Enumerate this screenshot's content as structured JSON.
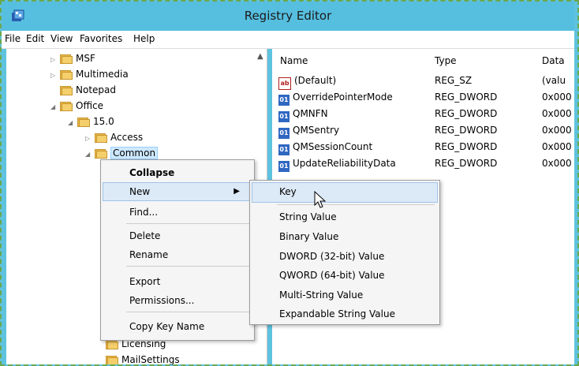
{
  "window": {
    "title": "Registry Editor"
  },
  "menubar": [
    "File",
    "Edit",
    "View",
    "Favorites",
    "Help"
  ],
  "tree": {
    "items": [
      {
        "label": "MSF",
        "expander": "▷"
      },
      {
        "label": "Multimedia",
        "expander": "▷"
      },
      {
        "label": "Notepad",
        "expander": ""
      },
      {
        "label": "Office",
        "expander": "◢"
      },
      {
        "label": "15.0",
        "expander": "◢"
      },
      {
        "label": "Access",
        "expander": "▷"
      },
      {
        "label": "Common",
        "expander": "◢"
      },
      {
        "label": "Licensing",
        "expander": ""
      },
      {
        "label": "MailSettings",
        "expander": ""
      }
    ]
  },
  "values": {
    "columns": [
      "Name",
      "Type",
      "Data"
    ],
    "rows": [
      {
        "icon": "string-value-icon",
        "name": "(Default)",
        "type": "REG_SZ",
        "data": "(valu"
      },
      {
        "icon": "binary-value-icon",
        "name": "OverridePointerMode",
        "type": "REG_DWORD",
        "data": "0x000"
      },
      {
        "icon": "binary-value-icon",
        "name": "QMNFN",
        "type": "REG_DWORD",
        "data": "0x000"
      },
      {
        "icon": "binary-value-icon",
        "name": "QMSentry",
        "type": "REG_DWORD",
        "data": "0x000"
      },
      {
        "icon": "binary-value-icon",
        "name": "QMSessionCount",
        "type": "REG_DWORD",
        "data": "0x000"
      },
      {
        "icon": "binary-value-icon",
        "name": "UpdateReliabilityData",
        "type": "REG_DWORD",
        "data": "0x000"
      }
    ]
  },
  "context_menu": {
    "items": [
      "Collapse",
      "New",
      "Find...",
      "Delete",
      "Rename",
      "Export",
      "Permissions...",
      "Copy Key Name"
    ]
  },
  "submenu": {
    "items": [
      "Key",
      "String Value",
      "Binary Value",
      "DWORD (32-bit) Value",
      "QWORD (64-bit) Value",
      "Multi-String Value",
      "Expandable String Value"
    ]
  },
  "colors": {
    "titlebar": "#56bfe0",
    "frame_border": "#6aa84f",
    "selection": "#cde8ff"
  }
}
